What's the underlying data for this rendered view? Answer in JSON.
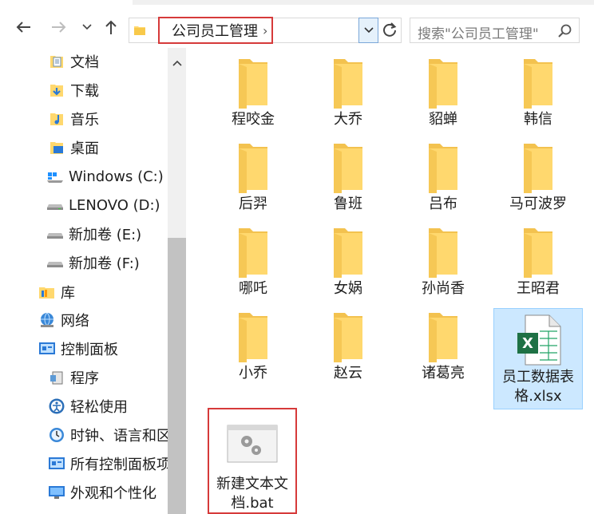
{
  "address": {
    "path": "公司员工管理",
    "separator": "›"
  },
  "search": {
    "placeholder": "搜索\"公司员工管理\""
  },
  "sidebar": {
    "items": [
      {
        "label": "文档",
        "icon": "documents-folder-icon"
      },
      {
        "label": "下载",
        "icon": "downloads-folder-icon"
      },
      {
        "label": "音乐",
        "icon": "music-folder-icon"
      },
      {
        "label": "桌面",
        "icon": "desktop-folder-icon"
      },
      {
        "label": "Windows (C:)",
        "icon": "windows-drive-icon"
      },
      {
        "label": "LENOVO (D:)",
        "icon": "drive-icon"
      },
      {
        "label": "新加卷 (E:)",
        "icon": "drive-icon"
      },
      {
        "label": "新加卷 (F:)",
        "icon": "drive-icon"
      },
      {
        "label": "库",
        "icon": "library-icon"
      },
      {
        "label": "网络",
        "icon": "network-icon"
      },
      {
        "label": "控制面板",
        "icon": "control-panel-icon"
      },
      {
        "label": "程序",
        "icon": "programs-icon"
      },
      {
        "label": "轻松使用",
        "icon": "ease-of-access-icon"
      },
      {
        "label": "时钟、语言和区",
        "icon": "clock-region-icon"
      },
      {
        "label": "所有控制面板项",
        "icon": "all-control-panel-icon"
      },
      {
        "label": "外观和个性化",
        "icon": "appearance-icon"
      }
    ]
  },
  "files": [
    {
      "name": "程咬金",
      "type": "folder"
    },
    {
      "name": "大乔",
      "type": "folder"
    },
    {
      "name": "貂蝉",
      "type": "folder"
    },
    {
      "name": "韩信",
      "type": "folder"
    },
    {
      "name": "后羿",
      "type": "folder"
    },
    {
      "name": "鲁班",
      "type": "folder"
    },
    {
      "name": "吕布",
      "type": "folder"
    },
    {
      "name": "马可波罗",
      "type": "folder"
    },
    {
      "name": "哪吒",
      "type": "folder"
    },
    {
      "name": "女娲",
      "type": "folder"
    },
    {
      "name": "孙尚香",
      "type": "folder"
    },
    {
      "name": "王昭君",
      "type": "folder"
    },
    {
      "name": "小乔",
      "type": "folder"
    },
    {
      "name": "赵云",
      "type": "folder"
    },
    {
      "name": "诸葛亮",
      "type": "folder"
    },
    {
      "name": "员工数据表格.xlsx",
      "type": "excel",
      "selected": true
    },
    {
      "name": "新建文本文档.bat",
      "type": "bat",
      "marked": true
    }
  ],
  "colors": {
    "selection_bg": "#cce8ff",
    "highlight_red": "#d63a3a",
    "folder_yellow": "#ffd86e"
  }
}
